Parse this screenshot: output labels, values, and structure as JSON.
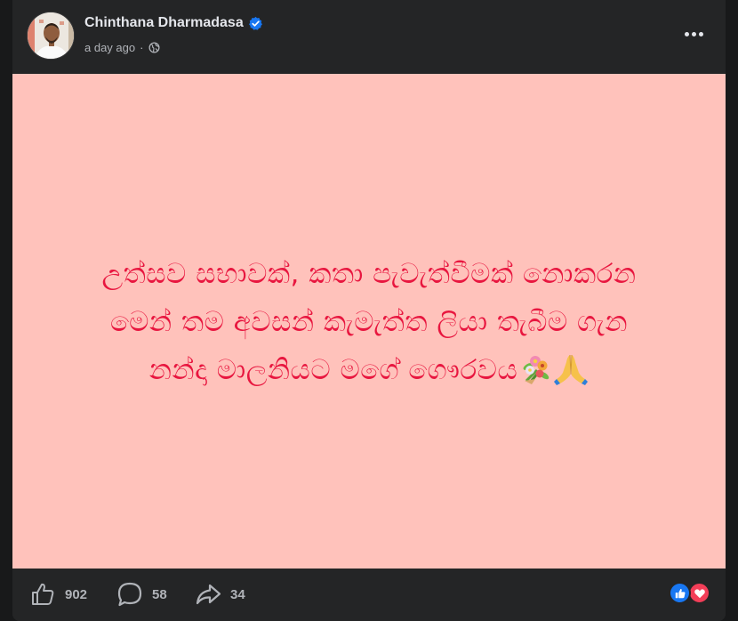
{
  "post": {
    "author": "Chinthana Dharmadasa",
    "time": "a day ago",
    "separator": "·",
    "privacy_icon": "globe-icon",
    "verified_icon": "verified-badge-icon",
    "menu_icon": "more-options-icon",
    "background_color": "#ffc2bb",
    "text_color": "#e8163f",
    "text_lines": [
      "උත්සව සභාවක්, කතා පැවැත්වීමක් නොකරන",
      "මෙන් තම අවසන් කැමැත්ත ලියා තැබීම ගැන",
      "නන්දා මාලනියට මගේ ගෞරවය"
    ],
    "text_emojis": [
      "bouquet-icon",
      "praying-hands-icon"
    ]
  },
  "actions": {
    "likes": "902",
    "comments": "58",
    "shares": "34",
    "reaction_icons": [
      "like-reaction-icon",
      "love-reaction-icon"
    ]
  },
  "colors": {
    "card": "#242526",
    "accent": "#1877f2",
    "love": "#f33e58"
  }
}
